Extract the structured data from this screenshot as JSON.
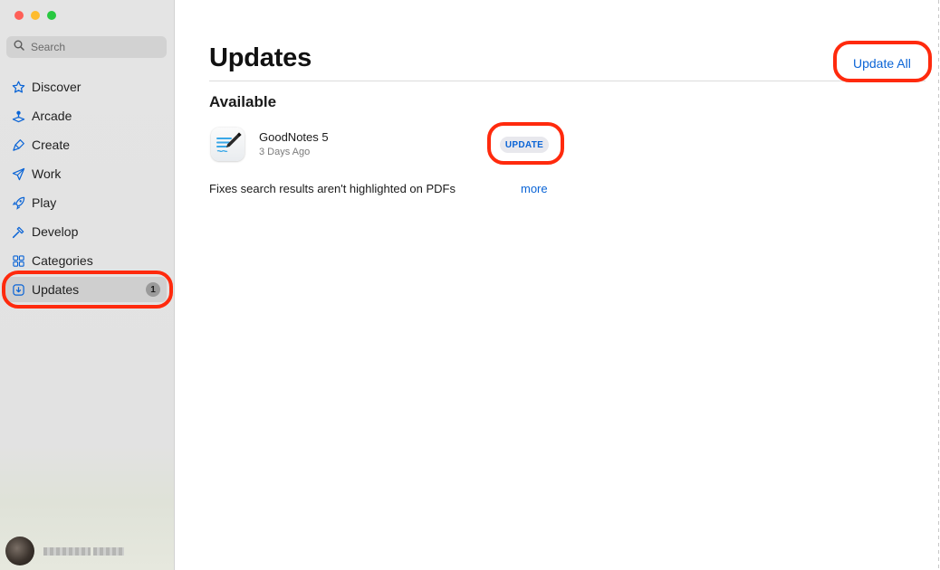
{
  "sidebar": {
    "search_placeholder": "Search",
    "items": [
      {
        "label": "Discover",
        "icon": "star-icon"
      },
      {
        "label": "Arcade",
        "icon": "joystick-icon"
      },
      {
        "label": "Create",
        "icon": "brush-icon"
      },
      {
        "label": "Work",
        "icon": "paper-plane-icon"
      },
      {
        "label": "Play",
        "icon": "rocket-icon"
      },
      {
        "label": "Develop",
        "icon": "hammer-icon"
      },
      {
        "label": "Categories",
        "icon": "grid-icon"
      },
      {
        "label": "Updates",
        "icon": "download-icon",
        "badge": "1",
        "selected": true
      }
    ]
  },
  "main": {
    "title": "Updates",
    "update_all_label": "Update All",
    "section_title": "Available",
    "apps": [
      {
        "name": "GoodNotes 5",
        "date": "3 Days Ago",
        "button_label": "UPDATE",
        "notes": "Fixes search results aren't highlighted on PDFs",
        "more_label": "more"
      }
    ]
  },
  "colors": {
    "accent": "#0a64d6",
    "annotation": "#ff2a0d",
    "sidebar_bg": "#e4e4e4",
    "badge": "#9a9a9a"
  }
}
